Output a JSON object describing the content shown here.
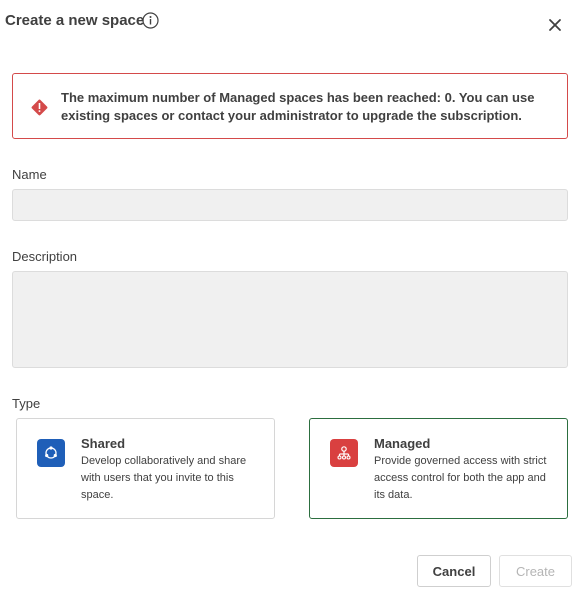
{
  "dialog": {
    "title": "Create a new space"
  },
  "alert": {
    "message": "The maximum number of Managed spaces has been reached: 0. You can use existing spaces or contact your administrator to upgrade the subscription.",
    "color": "#d44a4a"
  },
  "form": {
    "name_label": "Name",
    "name_value": "",
    "description_label": "Description",
    "description_value": "",
    "type_label": "Type"
  },
  "types": [
    {
      "title": "Shared",
      "description": "Develop collaboratively and share with users that you invite to this space.",
      "icon": "shared-space-icon",
      "icon_color": "#1f5fb8"
    },
    {
      "title": "Managed",
      "description": "Provide governed access with strict access control for both the app and its data.",
      "icon": "managed-space-icon",
      "icon_color": "#d94040",
      "selected": true,
      "selected_border": "#2c6e3f"
    }
  ],
  "buttons": {
    "cancel": "Cancel",
    "create": "Create"
  }
}
